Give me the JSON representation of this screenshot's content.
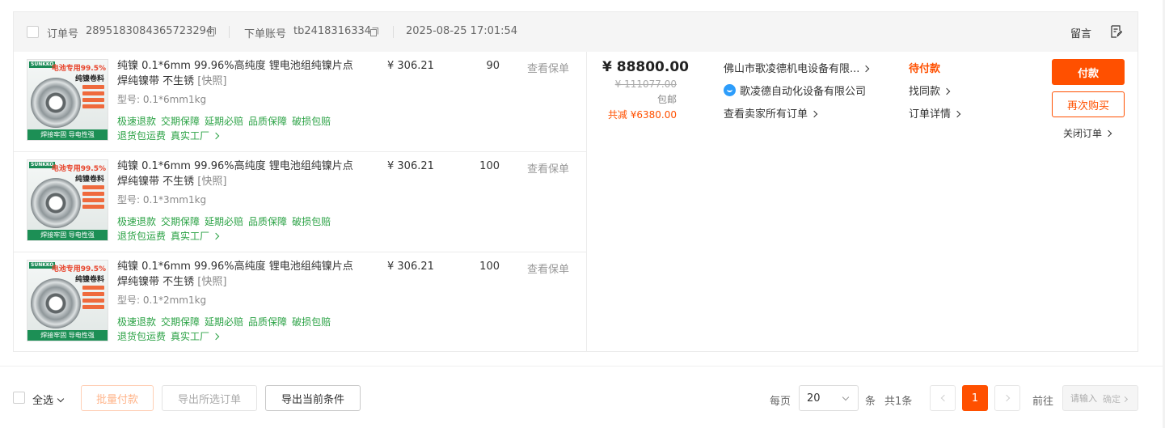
{
  "order": {
    "order_no_label": "订单号",
    "order_no": "2895183084365723294",
    "account_label": "下单账号",
    "account": "tb2418316334",
    "time": "2025-08-25 17:01:54",
    "message_label": "留言"
  },
  "items": [
    {
      "title": "纯镍 0.1*6mm 99.96%高纯度 锂电池组纯镍片点焊纯镍带 不生锈",
      "snapshot": "[快照]",
      "model_label": "型号:",
      "model": "0.1*6mm1kg",
      "services_line1": [
        "极速退款",
        "交期保障",
        "延期必赔",
        "品质保障",
        "破损包赔"
      ],
      "services_line2": [
        "退货包运费",
        "真实工厂"
      ],
      "price": "¥ 306.21",
      "qty": "90",
      "policy": "查看保单"
    },
    {
      "title": "纯镍 0.1*6mm 99.96%高纯度 锂电池组纯镍片点焊纯镍带 不生锈",
      "snapshot": "[快照]",
      "model_label": "型号:",
      "model": "0.1*3mm1kg",
      "services_line1": [
        "极速退款",
        "交期保障",
        "延期必赔",
        "品质保障",
        "破损包赔"
      ],
      "services_line2": [
        "退货包运费",
        "真实工厂"
      ],
      "price": "¥ 306.21",
      "qty": "100",
      "policy": "查看保单"
    },
    {
      "title": "纯镍 0.1*6mm 99.96%高纯度 锂电池组纯镍片点焊纯镍带 不生锈",
      "snapshot": "[快照]",
      "model_label": "型号:",
      "model": "0.1*2mm1kg",
      "services_line1": [
        "极速退款",
        "交期保障",
        "延期必赔",
        "品质保障",
        "破损包赔"
      ],
      "services_line2": [
        "退货包运费",
        "真实工厂"
      ],
      "price": "¥ 306.21",
      "qty": "100",
      "policy": "查看保单"
    }
  ],
  "thumb": {
    "brand": "SUNKKO",
    "line1": "电池专用99.5%",
    "line2": "纯镍卷料",
    "bottom": "焊接牢固 导电性强"
  },
  "payment": {
    "total": "¥ 88800.00",
    "original": "¥ 111077.00",
    "shipping": "包邮",
    "saved": "共减 ¥6380.00"
  },
  "seller": {
    "shop": "佛山市歌凌德机电设备有限...",
    "company": "歌凌德自动化设备有限公司",
    "all_orders": "查看卖家所有订单"
  },
  "status": {
    "text": "待付款",
    "similar": "找同款",
    "detail": "订单详情"
  },
  "actions": {
    "pay": "付款",
    "rebuy": "再次购买",
    "close": "关闭订单"
  },
  "footer": {
    "select_all": "全选",
    "batch_pay": "批量付款",
    "export_selected": "导出所选订单",
    "export_current": "导出当前条件"
  },
  "pagination": {
    "per_page_label": "每页",
    "page_size": "20",
    "unit": "条",
    "total": "共1条",
    "current_page": "1",
    "goto_label": "前往",
    "goto_placeholder": "请输入",
    "goto_confirm": "确定"
  },
  "colors": {
    "accent": "#ff5000",
    "service_green": "#2ba245",
    "header_bg": "#f5f5f5"
  }
}
